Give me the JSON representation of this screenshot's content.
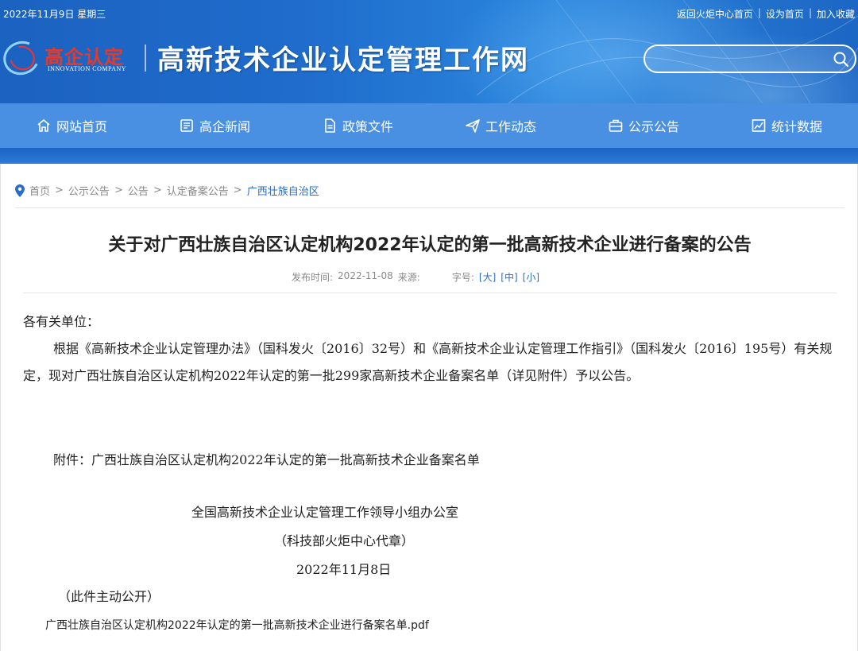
{
  "topbar": {
    "date": "2022年11月9日 星期三",
    "links": [
      "返回火炬中心首页",
      "设为首页",
      "加入收藏"
    ],
    "separator": "|"
  },
  "logo": {
    "name": "高企认定",
    "subtitle": "INNOVATION COMPANY"
  },
  "site_title": "高新技术企业认定管理工作网",
  "search": {
    "placeholder": "",
    "icon": "search-icon"
  },
  "nav": [
    {
      "label": "网站首页",
      "icon": "home-icon"
    },
    {
      "label": "高企新闻",
      "icon": "news-icon"
    },
    {
      "label": "政策文件",
      "icon": "document-icon"
    },
    {
      "label": "工作动态",
      "icon": "send-icon"
    },
    {
      "label": "公示公告",
      "icon": "briefcase-icon"
    },
    {
      "label": "统计数据",
      "icon": "chart-icon"
    }
  ],
  "breadcrumb": {
    "items": [
      "首页",
      "公示公告",
      "公告",
      "认定备案公告"
    ],
    "current": "广西壮族自治区",
    "separator": ">"
  },
  "article": {
    "title": "关于对广西壮族自治区认定机构2022年认定的第一批高新技术企业进行备案的公告",
    "meta": {
      "date_label": "发布时间:",
      "date": "2022-11-08",
      "source_label": "来源:",
      "font_label": "字号:",
      "font_sizes": [
        "[大]",
        "[中]",
        "[小]"
      ]
    },
    "greeting": "各有关单位：",
    "main_paragraph": "根据《高新技术企业认定管理办法》（国科发火〔2016〕32号）和《高新技术企业认定管理工作指引》（国科发火〔2016〕195号）有关规定，现对广西壮族自治区认定机构2022年认定的第一批299家高新技术企业备案名单（详见附件）予以公告。",
    "attachment_text": "附件：广西壮族自治区认定机构2022年认定的第一批高新技术企业备案名单",
    "signature_org": "全国高新技术企业认定管理工作领导小组办公室",
    "signature_note": "（科技部火炬中心代章）",
    "signature_date": "2022年11月8日",
    "public_note": "（此件主动公开）",
    "attachment_file": "广西壮族自治区认定机构2022年认定的第一批高新技术企业进行备案名单.pdf"
  },
  "colors": {
    "header_blue": "#1f6ccc",
    "nav_blue": "#4a90e2",
    "link_blue": "#2a6dc8",
    "logo_red": "#e43a2a"
  }
}
